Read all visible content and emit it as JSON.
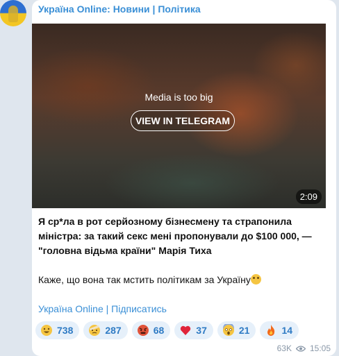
{
  "channel": {
    "name": "Україна Online: Новини | Політика"
  },
  "media": {
    "notice": "Media is too big",
    "button_label": "VIEW IN TELEGRAM",
    "duration": "2:09"
  },
  "post": {
    "headline": "Я ср*ла в рот серйозному бізнесмену та страпонила міністра: за такий секс мені пропонували до $100 000, — \"головна відьма країни\" Марія Тиха",
    "body": "Каже, що вона так мстить політикам за Україну",
    "subscribe_link": "Україна Online | Підписатись"
  },
  "reactions": [
    {
      "icon": "grinning-face-icon",
      "count": "738"
    },
    {
      "icon": "face-with-bandage-icon",
      "count": "287"
    },
    {
      "icon": "angry-face-icon",
      "count": "68"
    },
    {
      "icon": "red-heart-icon",
      "count": "37"
    },
    {
      "icon": "screaming-face-icon",
      "count": "21"
    },
    {
      "icon": "fire-icon",
      "count": "14"
    }
  ],
  "footer": {
    "views": "63K",
    "time": "15:05"
  },
  "colors": {
    "accent": "#3a8fd6",
    "reaction_bg": "#e6f0fa",
    "background": "#dfe6ee"
  }
}
